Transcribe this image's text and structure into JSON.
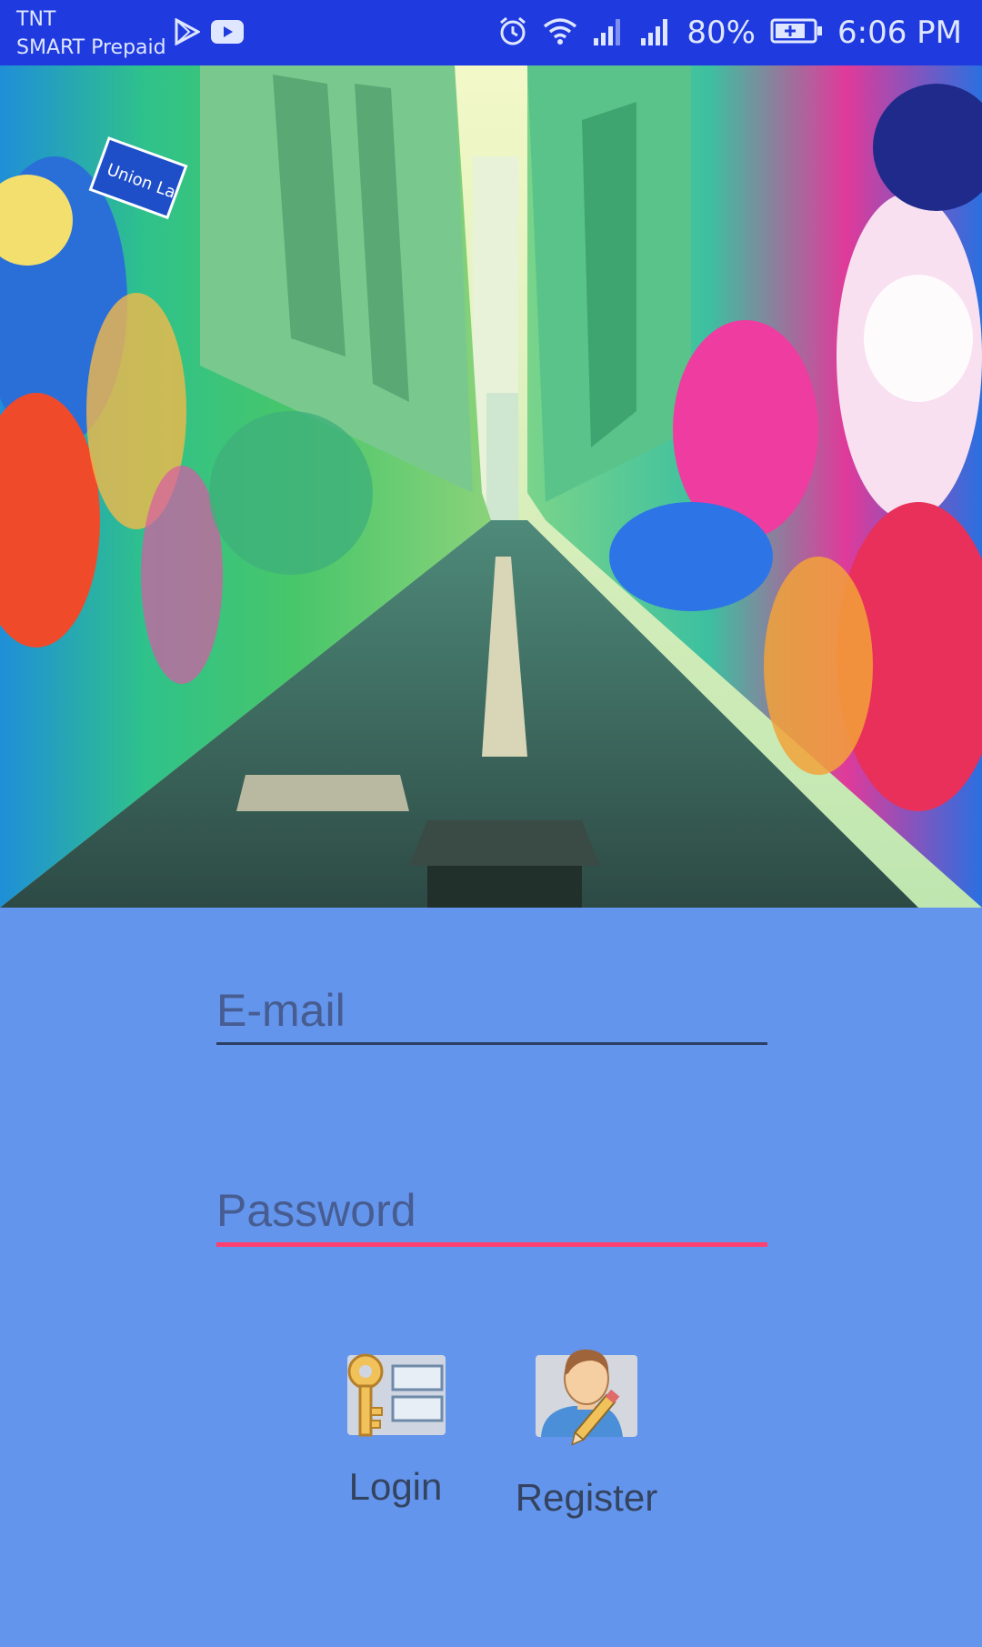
{
  "status_bar": {
    "carrier_line1": "TNT",
    "carrier_line2": "SMART Prepaid",
    "battery": "80%",
    "time": "6:06 PM",
    "icons": [
      "play-store-icon",
      "youtube-icon",
      "alarm-icon",
      "wifi-icon",
      "signal-icon",
      "signal-icon",
      "battery-charging-icon"
    ]
  },
  "hero": {
    "description": "graffiti-alley-photo",
    "sign_text": "Union La"
  },
  "form": {
    "email_placeholder": "E-mail",
    "password_placeholder": "Password"
  },
  "actions": {
    "login_label": "Login",
    "register_label": "Register"
  },
  "colors": {
    "status_bar": "#1f3be0",
    "background": "#6495ED",
    "password_underline": "#ff3f6f"
  }
}
